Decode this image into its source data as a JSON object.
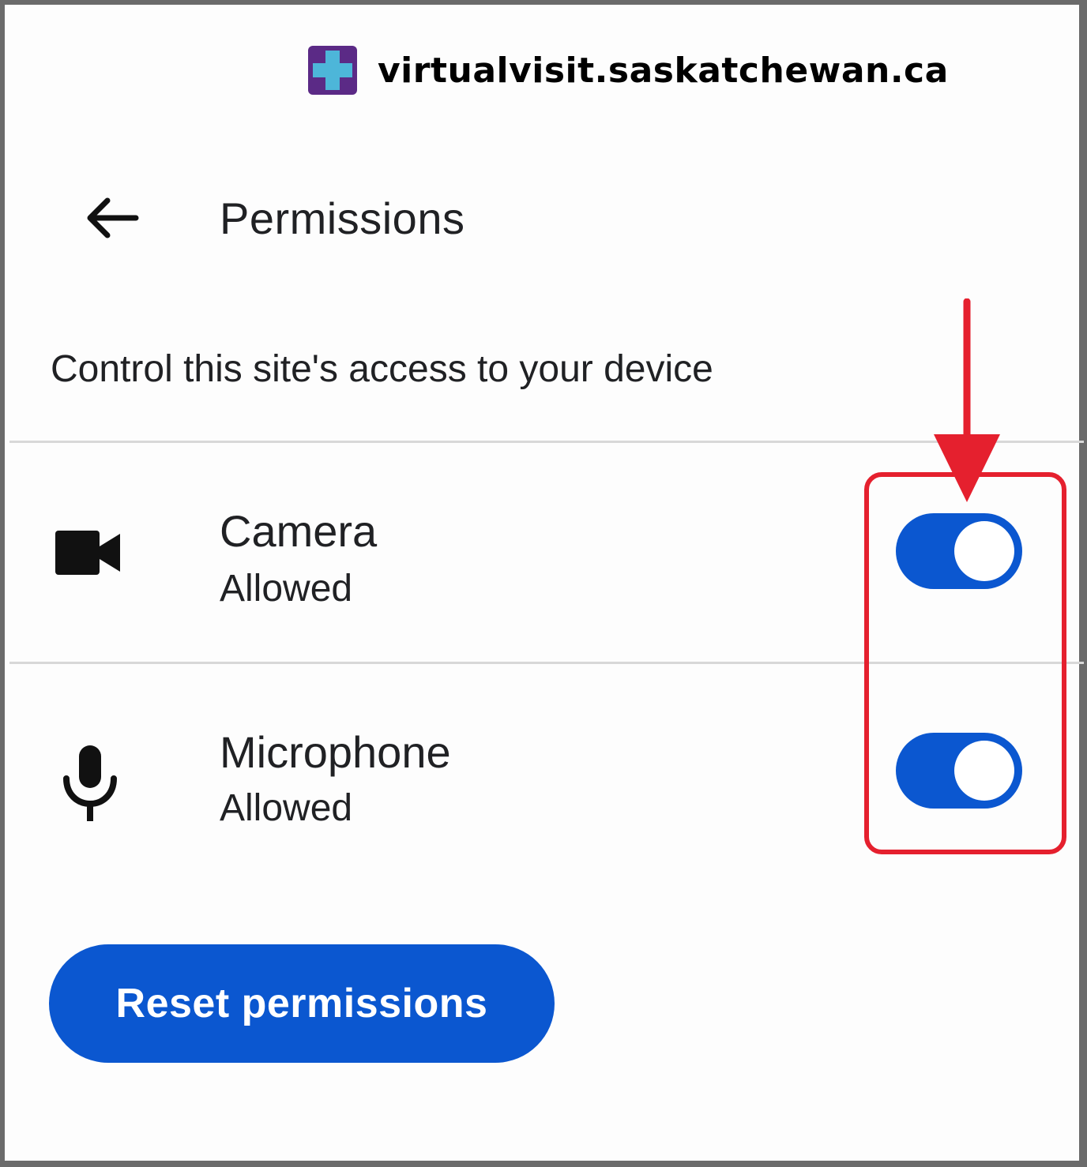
{
  "site": {
    "domain": "virtualvisit.saskatchewan.ca",
    "logo_icon": "medical-cross-icon",
    "logo_colors": {
      "background": "#5b2a86",
      "cross": "#4db6d9"
    }
  },
  "header": {
    "back_icon": "arrow-back-icon",
    "title": "Permissions"
  },
  "description": "Control this site's access to your device",
  "permissions": [
    {
      "name": "Camera",
      "status": "Allowed",
      "icon": "videocam-icon",
      "enabled": true
    },
    {
      "name": "Microphone",
      "status": "Allowed",
      "icon": "mic-icon",
      "enabled": true
    }
  ],
  "reset_button": {
    "label": "Reset permissions"
  },
  "annotation": {
    "color": "#e5202e",
    "shape": "arrow pointing to highlighted toggles"
  },
  "colors": {
    "accent": "#0b57d0",
    "text": "#202124",
    "annotation": "#e5202e"
  }
}
